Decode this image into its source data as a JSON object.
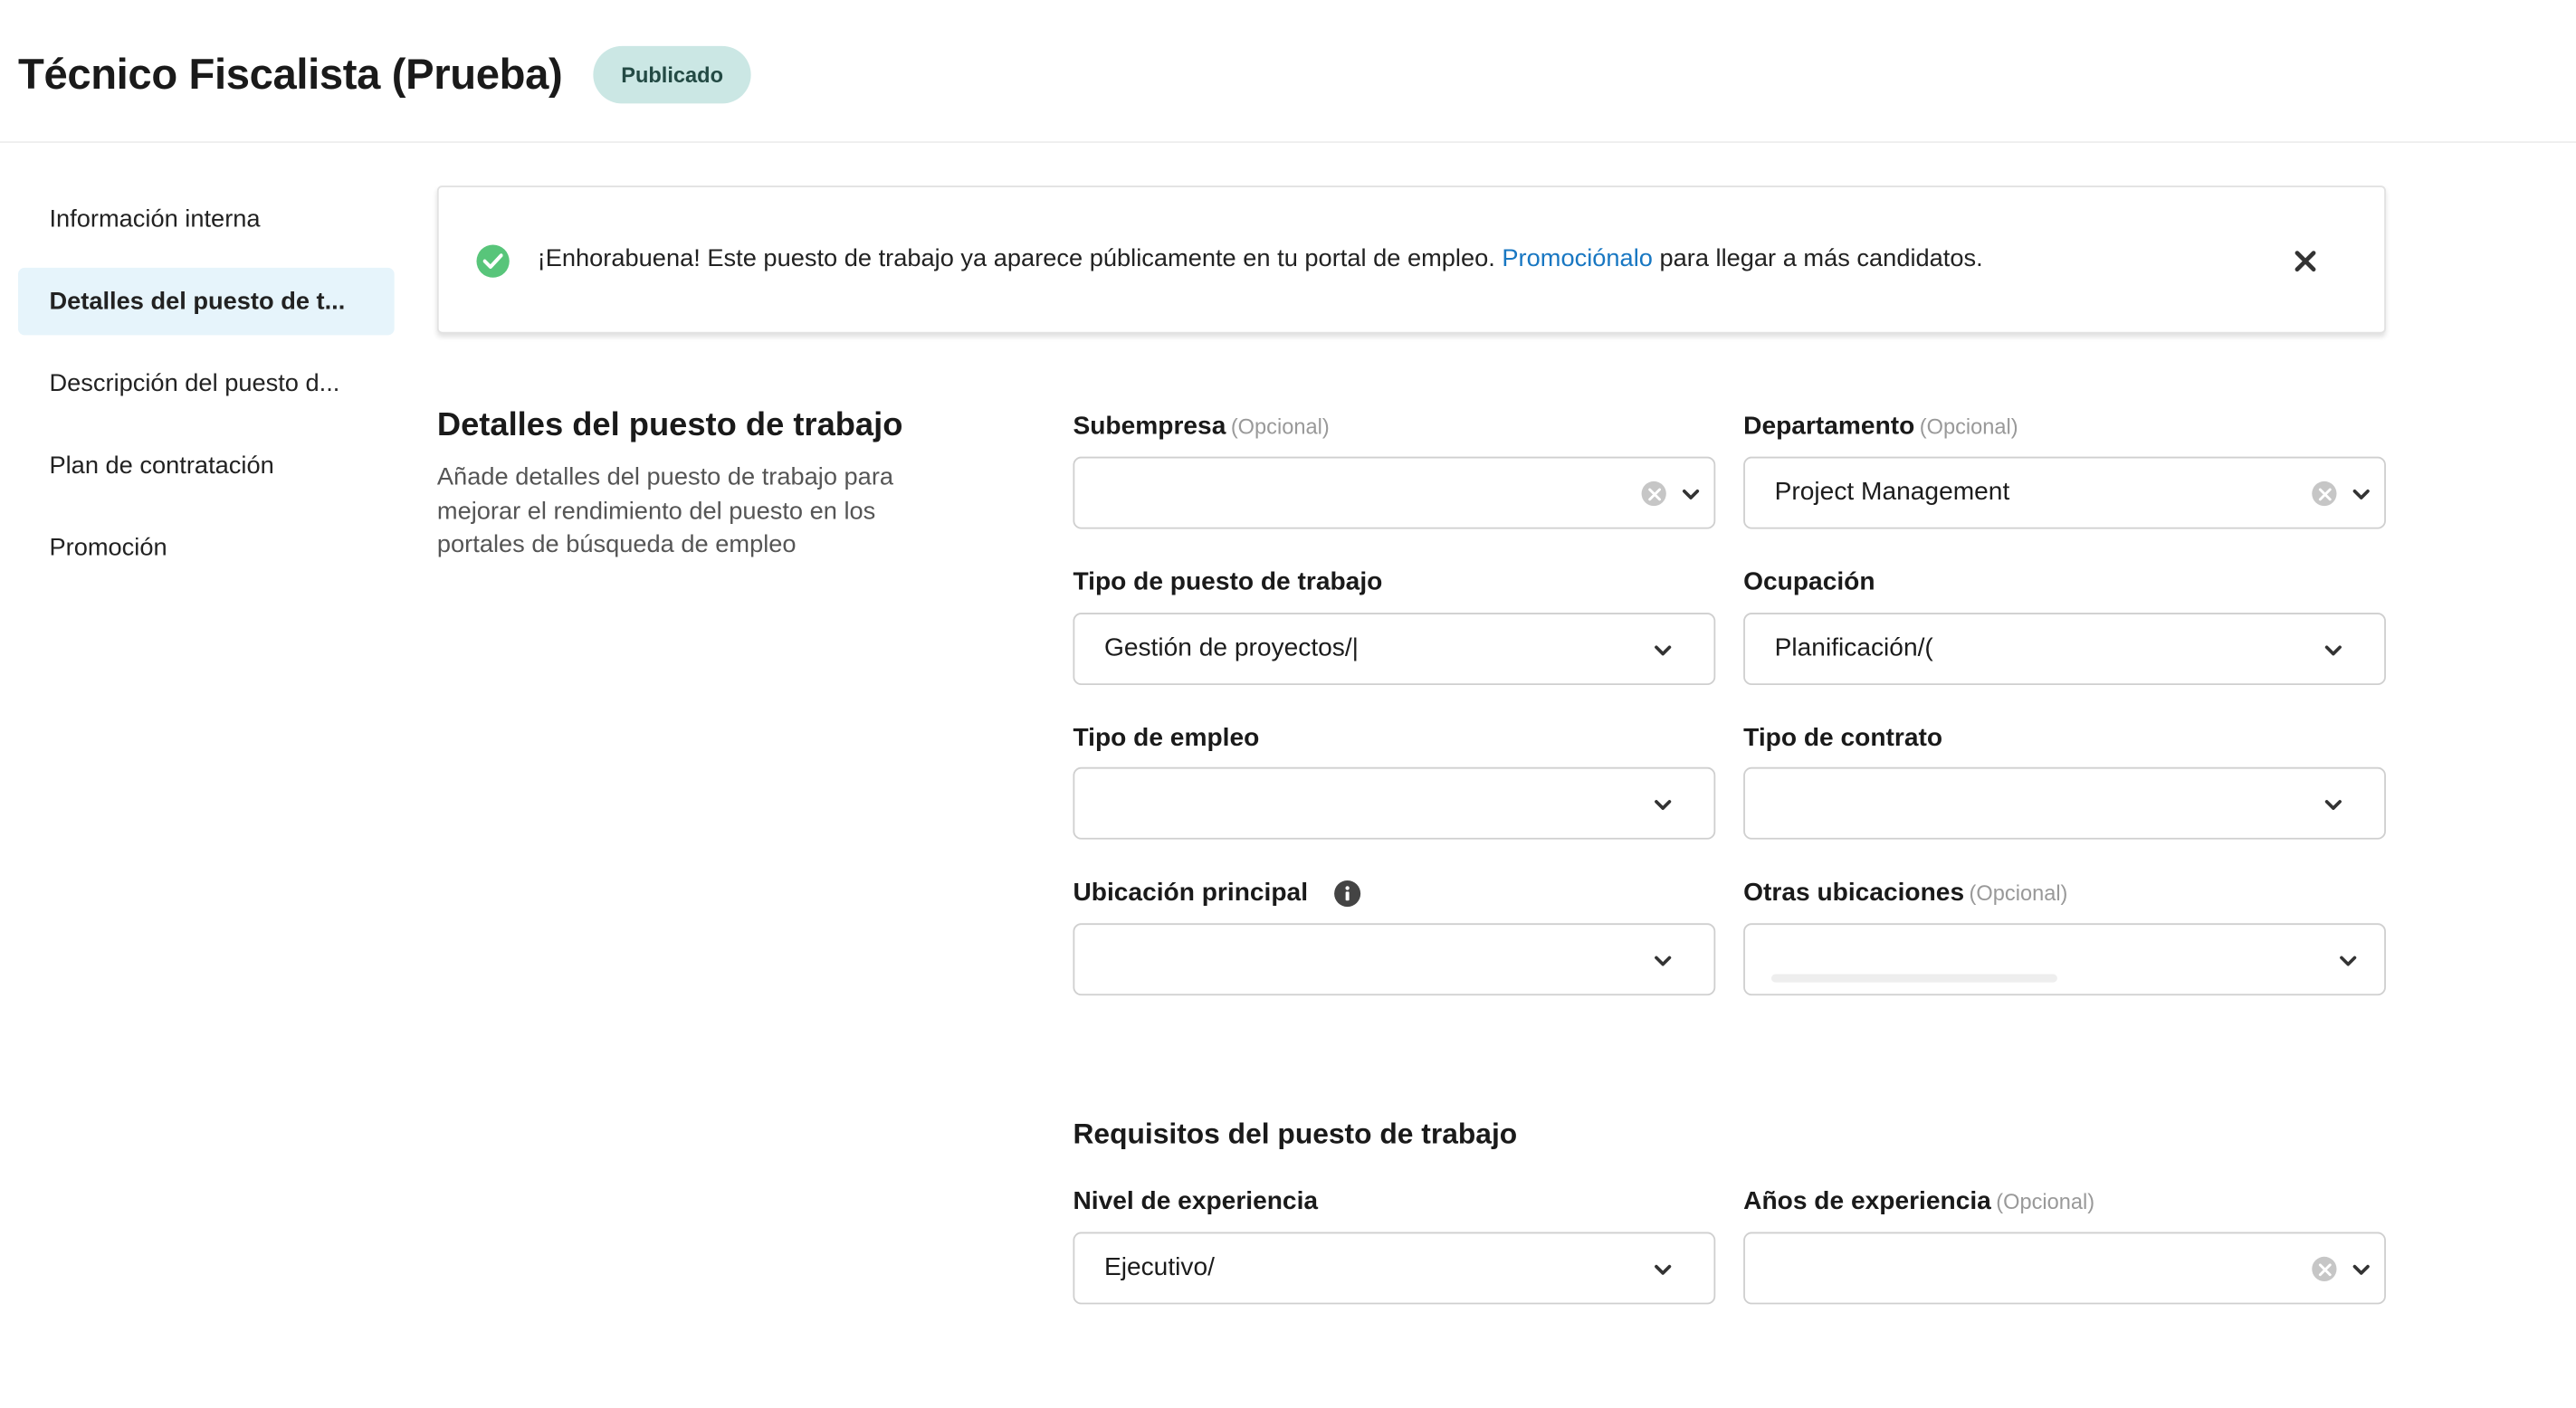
{
  "header": {
    "title": "Técnico Fiscalista (Prueba)",
    "status": "Publicado"
  },
  "sidebar": {
    "items": [
      {
        "label": "Información interna",
        "active": false
      },
      {
        "label": "Detalles del puesto de t...",
        "active": true
      },
      {
        "label": "Descripción del puesto d...",
        "active": false
      },
      {
        "label": "Plan de contratación",
        "active": false
      },
      {
        "label": "Promoción",
        "active": false
      }
    ]
  },
  "banner": {
    "icon": "check-circle-icon",
    "text_before": "¡Enhorabuena! Este puesto de trabajo ya aparece públicamente en tu portal de empleo. ",
    "link": "Promociónalo",
    "text_after": " para llegar a más candidatos.",
    "close_icon": "close-icon",
    "accent_color": "#58c57a",
    "link_color": "#1877c2"
  },
  "section": {
    "title": "Detalles del puesto de trabajo",
    "description": "Añade detalles del puesto de trabajo para mejorar el rendimiento del puesto en los portales de búsqueda de empleo"
  },
  "fields": {
    "subempresa": {
      "label": "Subempresa",
      "optional": "(Opcional)",
      "value": ""
    },
    "departamento": {
      "label": "Departamento",
      "optional": "(Opcional)",
      "value": "Project Management"
    },
    "tipo_puesto": {
      "label": "Tipo de puesto de trabajo",
      "value": "Gestión de proyectos/|"
    },
    "ocupacion": {
      "label": "Ocupación",
      "value": "Planificación/("
    },
    "tipo_empleo": {
      "label": "Tipo de empleo",
      "value": ""
    },
    "tipo_contrato": {
      "label": "Tipo de contrato",
      "value": ""
    },
    "ubicacion_principal": {
      "label": "Ubicación principal",
      "value": ""
    },
    "otras_ubicaciones": {
      "label": "Otras ubicaciones",
      "optional": "(Opcional)",
      "value": ""
    }
  },
  "requirements": {
    "title": "Requisitos del puesto de trabajo",
    "nivel_experiencia": {
      "label": "Nivel de experiencia",
      "value": "Ejecutivo/"
    },
    "anos_experiencia": {
      "label": "Años de experiencia",
      "optional": "(Opcional)",
      "value": ""
    }
  },
  "colors": {
    "status_bg": "#cbe7e4",
    "active_nav_bg": "#e6f4fb"
  }
}
